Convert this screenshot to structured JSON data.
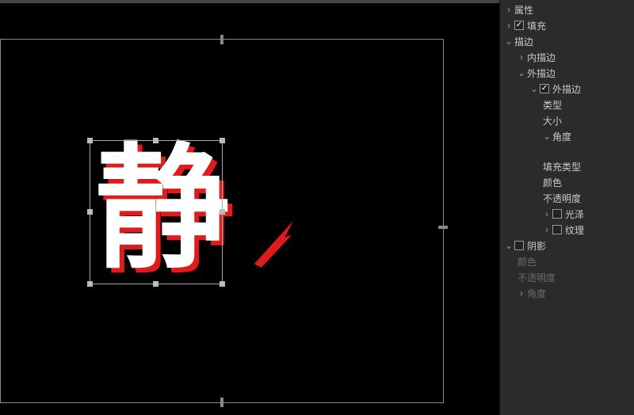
{
  "canvas": {
    "glyph": "静"
  },
  "panel": {
    "attrs": "属性",
    "fill": "填充",
    "stroke": "描边",
    "innerStroke": "内描边",
    "outerStroke": "外描边",
    "outerStroke2": "外描边",
    "type": "类型",
    "size": "大小",
    "angle": "角度",
    "fillType": "填充类型",
    "color": "颜色",
    "opacity": "不透明度",
    "gloss": "光泽",
    "texture": "纹理",
    "shadow": "阴影",
    "shColor": "颜色",
    "shOpacity": "不透明度",
    "shAngle": "角度"
  }
}
